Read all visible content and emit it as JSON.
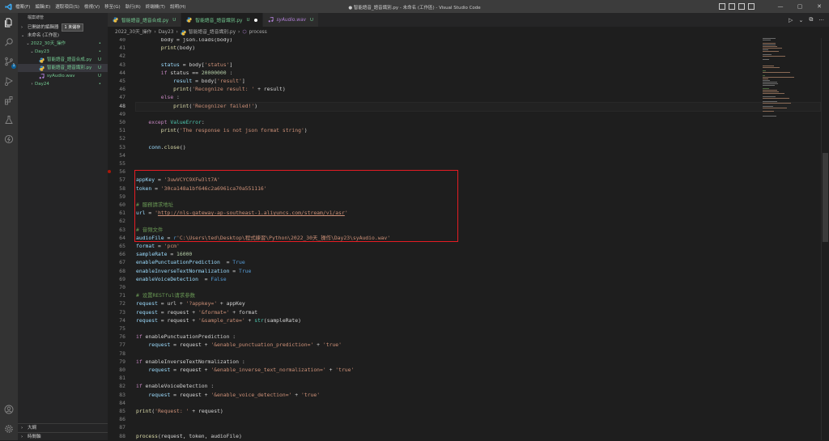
{
  "window": {
    "title": "● 智能語音_語音識別.py - 未命名 (工作區) - Visual Studio Code",
    "menu": [
      "檔案(F)",
      "編輯(E)",
      "選取項目(S)",
      "檢視(V)",
      "移至(G)",
      "執行(R)",
      "終端機(T)",
      "說明(H)"
    ],
    "controls": {
      "minimize": "—",
      "maximize": "▢",
      "close": "✕"
    }
  },
  "activity": {
    "icons": [
      "files-icon",
      "search-icon",
      "source-control-icon",
      "run-debug-icon",
      "extensions-icon",
      "testing-icon",
      "remote-icon"
    ],
    "source_control_badge": "1",
    "bottom": [
      "account-icon",
      "settings-gear-icon"
    ]
  },
  "sidebar": {
    "header": "檔案總管",
    "open_editors": "已開啟的編輯器",
    "unsaved_badge": "1 未儲存",
    "workspace": "未命名 (工作區)",
    "tree": [
      {
        "label": "2022_30天_操作",
        "level": 1,
        "chevron": "⌄",
        "status": "•",
        "kind": "folder"
      },
      {
        "label": "Day23",
        "level": 2,
        "chevron": "⌄",
        "status": "•",
        "kind": "folder"
      },
      {
        "label": "智能語音_語音合成.py",
        "level": 3,
        "chevron": "",
        "status": "U",
        "kind": "py"
      },
      {
        "label": "智能語音_語音識別.py",
        "level": 3,
        "chevron": "",
        "status": "U",
        "kind": "py",
        "selected": true
      },
      {
        "label": "syAudio.wav",
        "level": 3,
        "chevron": "",
        "status": "U",
        "kind": "wav"
      },
      {
        "label": "Day24",
        "level": 2,
        "chevron": "›",
        "status": "•",
        "kind": "folder"
      }
    ],
    "outline": "大綱",
    "timeline": "時間軸"
  },
  "tabs": [
    {
      "label": "智能語音_語音合成.py",
      "status": "U",
      "active": false,
      "kind": "py"
    },
    {
      "label": "智能語音_語音識別.py",
      "status": "U",
      "active": true,
      "kind": "py",
      "dirty": true
    },
    {
      "label": "syAudio.wav",
      "status": "U",
      "active": false,
      "kind": "wav"
    }
  ],
  "editor_actions": [
    "▷",
    "⌄",
    "⧉",
    "···"
  ],
  "breadcrumb": [
    "2022_30天_操作",
    "Day23",
    "智能語音_語音識別.py",
    "process"
  ],
  "editor": {
    "current_line": "48",
    "lines": [
      {
        "n": "40",
        "tokens": [
          [
            "",
            "        body = json.loads(body)"
          ]
        ]
      },
      {
        "n": "41",
        "tokens": [
          [
            "",
            "        "
          ],
          [
            "fn",
            "print"
          ],
          [
            "",
            "(body)"
          ]
        ]
      },
      {
        "n": "42",
        "tokens": []
      },
      {
        "n": "43",
        "tokens": [
          [
            "",
            "        "
          ],
          [
            "var",
            "status"
          ],
          [
            "",
            " = body["
          ],
          [
            "str",
            "'status'"
          ],
          [
            "",
            "]"
          ]
        ]
      },
      {
        "n": "44",
        "tokens": [
          [
            "",
            "        "
          ],
          [
            "kw",
            "if"
          ],
          [
            "",
            " status == "
          ],
          [
            "num",
            "20000000"
          ],
          [
            "",
            " :"
          ]
        ]
      },
      {
        "n": "45",
        "tokens": [
          [
            "",
            "            "
          ],
          [
            "var",
            "result"
          ],
          [
            "",
            " = body["
          ],
          [
            "str",
            "'result'"
          ],
          [
            "",
            "]"
          ]
        ]
      },
      {
        "n": "46",
        "tokens": [
          [
            "",
            "            "
          ],
          [
            "fn",
            "print"
          ],
          [
            "",
            "("
          ],
          [
            "str",
            "'Recognize result: '"
          ],
          [
            "",
            " + result)"
          ]
        ]
      },
      {
        "n": "47",
        "tokens": [
          [
            "",
            "        "
          ],
          [
            "kw",
            "else"
          ],
          [
            "",
            " :"
          ]
        ]
      },
      {
        "n": "48",
        "tokens": [
          [
            "",
            "            "
          ],
          [
            "fn",
            "print"
          ],
          [
            "",
            "("
          ],
          [
            "str",
            "'Recognizer failed!'"
          ],
          [
            "",
            ")"
          ]
        ]
      },
      {
        "n": "49",
        "tokens": []
      },
      {
        "n": "50",
        "tokens": [
          [
            "",
            "    "
          ],
          [
            "kw",
            "except"
          ],
          [
            "",
            " "
          ],
          [
            "cls",
            "ValueError"
          ],
          [
            "",
            ":"
          ]
        ]
      },
      {
        "n": "51",
        "tokens": [
          [
            "",
            "        "
          ],
          [
            "fn",
            "print"
          ],
          [
            "",
            "("
          ],
          [
            "str",
            "'The response is not json format string'"
          ],
          [
            "",
            ")"
          ]
        ]
      },
      {
        "n": "52",
        "tokens": []
      },
      {
        "n": "53",
        "tokens": [
          [
            "",
            "    "
          ],
          [
            "var",
            "conn"
          ],
          [
            "",
            "."
          ],
          [
            "fn",
            "close"
          ],
          [
            "",
            "()"
          ]
        ]
      },
      {
        "n": "54",
        "tokens": []
      },
      {
        "n": "55",
        "tokens": []
      },
      {
        "n": "56",
        "tokens": []
      },
      {
        "n": "57",
        "tokens": [
          [
            "var",
            "appKey"
          ],
          [
            "",
            " = "
          ],
          [
            "str",
            "'3uwVCYC9XFw3lt7A'"
          ]
        ]
      },
      {
        "n": "58",
        "tokens": [
          [
            "var",
            "token"
          ],
          [
            "",
            " = "
          ],
          [
            "str",
            "'30ca148a1bf646c2a6961ca70a551116'"
          ]
        ]
      },
      {
        "n": "59",
        "tokens": []
      },
      {
        "n": "60",
        "tokens": [
          [
            "cmt",
            "# 服務請求地址"
          ]
        ]
      },
      {
        "n": "61",
        "tokens": [
          [
            "var",
            "url"
          ],
          [
            "",
            " = "
          ],
          [
            "str",
            "'"
          ],
          [
            "str url",
            "http://nls-gateway-ap-southeast-1.aliyuncs.com/stream/v1/asr"
          ],
          [
            "str",
            "'"
          ]
        ]
      },
      {
        "n": "62",
        "tokens": []
      },
      {
        "n": "63",
        "tokens": [
          [
            "cmt",
            "# 音頻文件"
          ]
        ]
      },
      {
        "n": "64",
        "tokens": [
          [
            "var",
            "audioFile"
          ],
          [
            "",
            " = "
          ],
          [
            "kb",
            "r"
          ],
          [
            "str",
            "'C:\\Users\\ted\\Desktop\\程式練習\\Python\\2022_30天_操作\\Day23\\syAudio.wav'"
          ]
        ]
      },
      {
        "n": "65",
        "tokens": [
          [
            "var",
            "format"
          ],
          [
            "",
            " = "
          ],
          [
            "str",
            "'pcm'"
          ]
        ]
      },
      {
        "n": "66",
        "tokens": [
          [
            "var",
            "sampleRate"
          ],
          [
            "",
            " = "
          ],
          [
            "num",
            "16000"
          ]
        ]
      },
      {
        "n": "67",
        "tokens": [
          [
            "var",
            "enablePunctuationPrediction"
          ],
          [
            "",
            "  = "
          ],
          [
            "kb",
            "True"
          ]
        ]
      },
      {
        "n": "68",
        "tokens": [
          [
            "var",
            "enableInverseTextNormalization"
          ],
          [
            "",
            " = "
          ],
          [
            "kb",
            "True"
          ]
        ]
      },
      {
        "n": "69",
        "tokens": [
          [
            "var",
            "enableVoiceDetection"
          ],
          [
            "",
            "  = "
          ],
          [
            "kb",
            "False"
          ]
        ]
      },
      {
        "n": "70",
        "tokens": []
      },
      {
        "n": "71",
        "tokens": [
          [
            "cmt",
            "# 设置RESTful请求参数"
          ]
        ]
      },
      {
        "n": "72",
        "tokens": [
          [
            "var",
            "request"
          ],
          [
            "",
            " = url + "
          ],
          [
            "str",
            "'?appkey='"
          ],
          [
            "",
            " + appKey"
          ]
        ]
      },
      {
        "n": "73",
        "tokens": [
          [
            "var",
            "request"
          ],
          [
            "",
            " = request + "
          ],
          [
            "str",
            "'&format='"
          ],
          [
            "",
            " + format"
          ]
        ]
      },
      {
        "n": "74",
        "tokens": [
          [
            "var",
            "request"
          ],
          [
            "",
            " = request + "
          ],
          [
            "str",
            "'&sample_rate='"
          ],
          [
            "",
            " + "
          ],
          [
            "cls",
            "str"
          ],
          [
            "",
            "(sampleRate)"
          ]
        ]
      },
      {
        "n": "75",
        "tokens": []
      },
      {
        "n": "76",
        "tokens": [
          [
            "kw",
            "if"
          ],
          [
            "",
            " enablePunctuationPrediction :"
          ]
        ]
      },
      {
        "n": "77",
        "tokens": [
          [
            "",
            "    "
          ],
          [
            "var",
            "request"
          ],
          [
            "",
            " = request + "
          ],
          [
            "str",
            "'&enable_punctuation_prediction='"
          ],
          [
            "",
            " + "
          ],
          [
            "str",
            "'true'"
          ]
        ]
      },
      {
        "n": "78",
        "tokens": []
      },
      {
        "n": "79",
        "tokens": [
          [
            "kw",
            "if"
          ],
          [
            "",
            " enableInverseTextNormalization :"
          ]
        ]
      },
      {
        "n": "80",
        "tokens": [
          [
            "",
            "    "
          ],
          [
            "var",
            "request"
          ],
          [
            "",
            " = request + "
          ],
          [
            "str",
            "'&enable_inverse_text_normalization='"
          ],
          [
            "",
            " + "
          ],
          [
            "str",
            "'true'"
          ]
        ]
      },
      {
        "n": "81",
        "tokens": []
      },
      {
        "n": "82",
        "tokens": [
          [
            "kw",
            "if"
          ],
          [
            "",
            " enableVoiceDetection :"
          ]
        ]
      },
      {
        "n": "83",
        "tokens": [
          [
            "",
            "    "
          ],
          [
            "var",
            "request"
          ],
          [
            "",
            " = request + "
          ],
          [
            "str",
            "'&enable_voice_detection='"
          ],
          [
            "",
            " + "
          ],
          [
            "str",
            "'true'"
          ]
        ]
      },
      {
        "n": "84",
        "tokens": []
      },
      {
        "n": "85",
        "tokens": [
          [
            "fn",
            "print"
          ],
          [
            "",
            "("
          ],
          [
            "str",
            "'Request: '"
          ],
          [
            "",
            " + request)"
          ]
        ]
      },
      {
        "n": "86",
        "tokens": []
      },
      {
        "n": "87",
        "tokens": []
      },
      {
        "n": "88",
        "tokens": [
          [
            "fn",
            "process"
          ],
          [
            "",
            "(request, token, audioFile)"
          ]
        ]
      }
    ]
  },
  "colors": {
    "highlight_box": "#e51c23",
    "status_untracked": "#73c991",
    "accent": "#0e639c"
  }
}
